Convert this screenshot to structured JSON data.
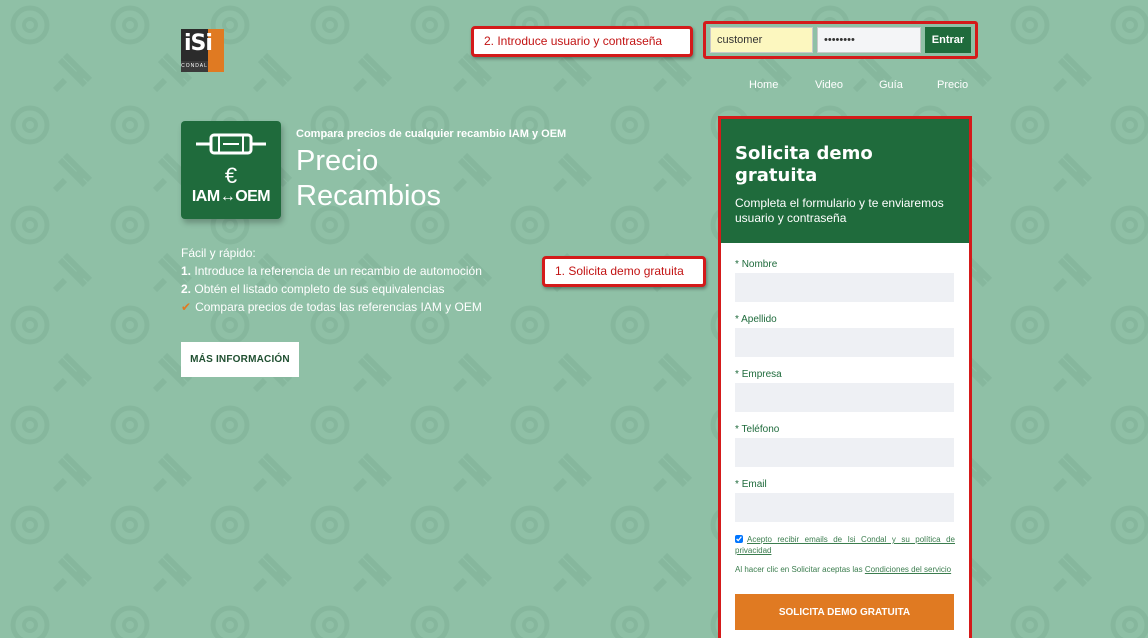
{
  "logo": {
    "text": "iSi",
    "subtext": "CONDAL"
  },
  "callouts": {
    "login": "2. Introduce usuario y contraseña",
    "demo": "1. Solicita demo gratuita"
  },
  "login": {
    "username_value": "customer",
    "password_value": "••••••••",
    "submit_label": "Entrar"
  },
  "nav": {
    "items": [
      "Home",
      "Video",
      "Guía",
      "Precio"
    ]
  },
  "hero": {
    "icon_euro": "€",
    "icon_text": "IAM↔OEM",
    "subtitle": "Compara precios de cualquier recambio IAM y OEM",
    "title_line1": "Precio",
    "title_line2": "Recambios"
  },
  "features": {
    "intro": "Fácil y rápido:",
    "step1_num": "1.",
    "step1": "Introduce la referencia de un recambio de automoción",
    "step2_num": "2.",
    "step2": "Obtén el listado completo de sus equivalencias",
    "check_item": "Compara precios de todas las referencias IAM y OEM"
  },
  "more_button": "MÁS INFORMACIÓN",
  "form": {
    "title": "Solicita demo gratuita",
    "description": "Completa el formulario y te enviaremos usuario y contraseña",
    "required_mark": "*",
    "fields": [
      "Nombre",
      "Apellido",
      "Empresa",
      "Teléfono",
      "Email"
    ],
    "consent": "Acepto recibir emails de Isi Condal y su política de privacidad",
    "terms_prefix": "Al hacer clic en Solicitar aceptas las",
    "terms_link": "Condiciones del servicio",
    "submit": "SOLICITA DEMO GRATUITA"
  },
  "colors": {
    "brand_green": "#1f6b3c",
    "accent_orange": "#e07a22",
    "background": "#8fc0a6",
    "callout_red": "#d41a1a"
  }
}
